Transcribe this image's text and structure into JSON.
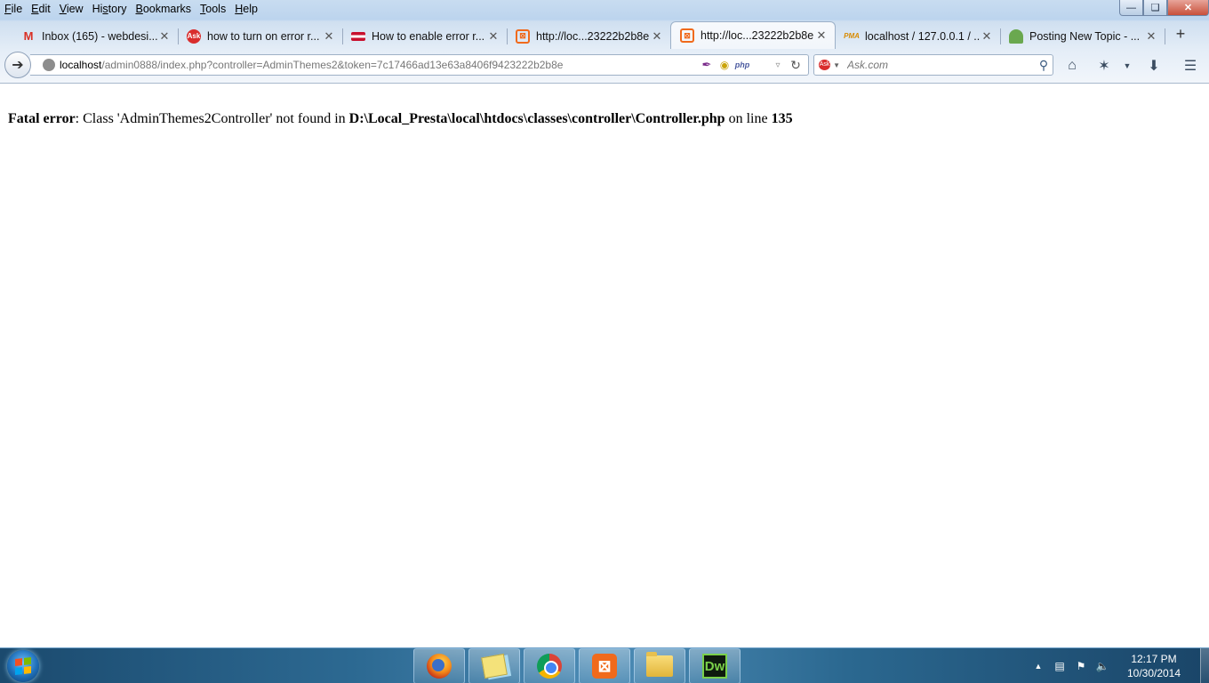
{
  "menu": [
    {
      "pre": "",
      "u": "F",
      "post": "ile"
    },
    {
      "pre": "",
      "u": "E",
      "post": "dit"
    },
    {
      "pre": "",
      "u": "V",
      "post": "iew"
    },
    {
      "pre": "Hi",
      "u": "s",
      "post": "tory"
    },
    {
      "pre": "",
      "u": "B",
      "post": "ookmarks"
    },
    {
      "pre": "",
      "u": "T",
      "post": "ools"
    },
    {
      "pre": "",
      "u": "H",
      "post": "elp"
    }
  ],
  "tabs": [
    {
      "label": "Inbox (165) - webdesi...",
      "icon": "gmail-icon"
    },
    {
      "label": "how to turn on error r...",
      "icon": "ask-icon"
    },
    {
      "label": "How to enable error r...",
      "icon": "flag-icon"
    },
    {
      "label": "http://loc...23222b2b8e",
      "icon": "xampp-icon"
    },
    {
      "label": "http://loc...23222b2b8e",
      "icon": "xampp-icon",
      "active": true
    },
    {
      "label": "localhost / 127.0.0.1 / ...",
      "icon": "phpmyadmin-icon"
    },
    {
      "label": "Posting New Topic - ...",
      "icon": "forum-icon"
    }
  ],
  "url": {
    "host": "localhost",
    "rest": "/admin0888/index.php?controller=AdminThemes2&token=7c17466ad13e63a8406f9423222b2b8e"
  },
  "search": {
    "placeholder": "Ask.com",
    "engine_icon": "ask-icon"
  },
  "page": {
    "error_label": "Fatal error",
    "error_message": ": Class 'AdminThemes2Controller' not found in ",
    "file_path": "D:\\Local_Presta\\local\\htdocs\\classes\\controller\\Controller.php",
    "line_text": " on line ",
    "line_number": "135"
  },
  "taskbar": {
    "apps": [
      "firefox-icon",
      "sticky-notes-icon",
      "chrome-icon",
      "xampp-icon",
      "file-explorer-icon",
      "dreamweaver-icon"
    ],
    "dw_label": "Dw",
    "xampp_label": "⊠",
    "time": "12:17 PM",
    "date": "10/30/2014"
  },
  "colors": {
    "active_tab": "#f2f6fb",
    "taskbar": "#2d6a93",
    "xampp": "#f06a1c"
  }
}
